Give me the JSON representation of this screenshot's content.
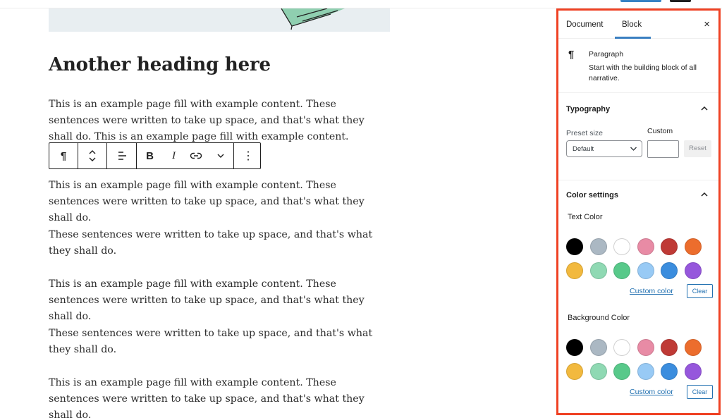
{
  "editor": {
    "heading": "Another heading here",
    "paragraphs": [
      "This is an example page fill with example content. These sentences were written to take up space, and that's what they shall do. This is an example page fill with example content. These sentences were written to take up",
      "This is an example page fill with example content. These sentences were written to take up space, and that's what they shall do.",
      "These sentences were written to take up space, and that's what they shall do.",
      "This is an example page fill with example content. These sentences were written to take up space, and that's what they shall do.",
      "These sentences were written to take up space, and that's what they shall do.",
      "This is an example page fill with example content. These sentences were written to take up space, and that's what they shall do."
    ]
  },
  "toolbar": {
    "paragraph_icon": "¶",
    "bold_label": "B",
    "italic_label": "I",
    "more_icon": "⋮"
  },
  "sidebar": {
    "tabs": [
      {
        "label": "Document",
        "active": false
      },
      {
        "label": "Block",
        "active": true
      }
    ],
    "close_icon": "×",
    "block": {
      "icon": "¶",
      "title": "Paragraph",
      "description": "Start with the building block of all narrative."
    },
    "typography": {
      "title": "Typography",
      "preset_label": "Preset size",
      "preset_value": "Default",
      "custom_label": "Custom",
      "custom_value": "",
      "reset_label": "Reset"
    },
    "color_settings": {
      "title": "Color settings",
      "text_color": {
        "label": "Text Color",
        "custom_link": "Custom color",
        "clear_label": "Clear"
      },
      "background_color": {
        "label": "Background Color",
        "custom_link": "Custom color",
        "clear_label": "Clear"
      },
      "palette": [
        {
          "name": "black",
          "hex": "#000000"
        },
        {
          "name": "cyan-bluish-gray",
          "hex": "#abb8c3"
        },
        {
          "name": "white",
          "hex": "#ffffff"
        },
        {
          "name": "pale-pink",
          "hex": "#e88ba5"
        },
        {
          "name": "vivid-red",
          "hex": "#bf3a36"
        },
        {
          "name": "luminous-vivid-orange",
          "hex": "#ec6d2d"
        },
        {
          "name": "luminous-vivid-amber",
          "hex": "#f2b93e"
        },
        {
          "name": "light-green-cyan",
          "hex": "#8fd9b3"
        },
        {
          "name": "vivid-green-cyan",
          "hex": "#58c98a"
        },
        {
          "name": "pale-cyan-blue",
          "hex": "#98caf5"
        },
        {
          "name": "vivid-cyan-blue",
          "hex": "#3b8dde"
        },
        {
          "name": "vivid-purple",
          "hex": "#9657dc"
        }
      ]
    }
  },
  "colors": {
    "highlight_border": "#ef4123",
    "accent": "#2271b1"
  }
}
